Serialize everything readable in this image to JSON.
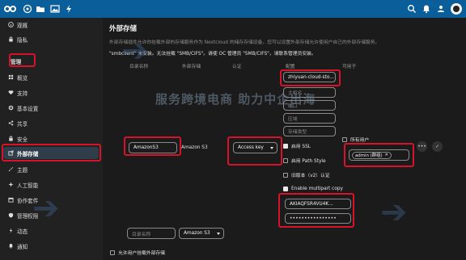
{
  "sidebar": {
    "items": [
      {
        "label": "观概"
      },
      {
        "label": "隐私"
      },
      {
        "label": "管理"
      },
      {
        "label": "概览"
      },
      {
        "label": "支持"
      },
      {
        "label": "基本设置"
      },
      {
        "label": "共享"
      },
      {
        "label": "安全"
      },
      {
        "label": "外部存储"
      },
      {
        "label": "主题"
      },
      {
        "label": "人工智能"
      },
      {
        "label": "协作套件"
      },
      {
        "label": "管理权限"
      },
      {
        "label": "动态"
      },
      {
        "label": "通知"
      }
    ]
  },
  "main": {
    "title": "外部存储",
    "description": "外部存储插件允许你挂载外部的存储服务作为 Nextcloud 的储存存储设备，您可以设置外部存储允许使用户自己的外部存储服务。",
    "warning": "\"smbclient\" 未安装。无法挂载 \"SMB/CIFS\"。请使 OC 管理员 \"SMB/CIFS\"，请联系管理员安装。",
    "columns": [
      "目录名称",
      "外部存储",
      "认证",
      "配置",
      "可用于"
    ],
    "row": {
      "folder_name": "AmazonS3",
      "storage_type": "Amazon S3",
      "auth": "Access key",
      "config": {
        "bucket": "zhiyuan-cloud-sto...",
        "hostname_ph": "主机名",
        "port_ph": "端口",
        "region_ph": "区域",
        "storage_class_ph": "存储类型",
        "enable_ssl": "启用 SSL",
        "enable_path_style": "启用 Path Style",
        "legacy_auth": "旧版本（v2）认证",
        "multipart": "Enable multipart copy",
        "access_key": "AKIAQFSR4VU4K...",
        "secret_key": "••••••••••••••••"
      },
      "all_users": "所有用户",
      "group_tag": "admin (群组)"
    },
    "new_row": {
      "folder_placeholder": "目录名称",
      "storage_type": "Amazon S3"
    },
    "allow_users_label": "允许用户挂载外部存储"
  },
  "watermark": {
    "text": "服务跨境电商 助力中企出海"
  },
  "colors": {
    "topbar": "#0a5e9a",
    "highlight": "#d6132a",
    "background": "#1b1b1b"
  }
}
